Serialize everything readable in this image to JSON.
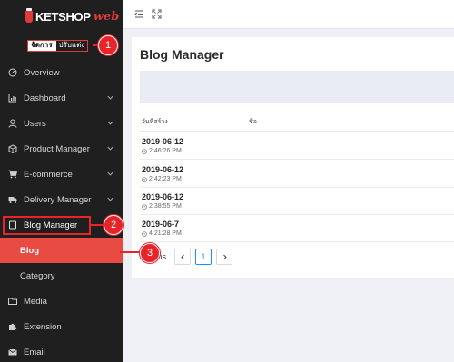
{
  "brand": {
    "name_main": "KETSHOP",
    "name_accent": "web",
    "accent_color": "#e23a3a"
  },
  "user": {
    "role_label": "จัดการ",
    "role_label2": "ปรับแต่ง"
  },
  "sidebar": {
    "items": [
      {
        "label": "Overview",
        "icon": "gauge-icon"
      },
      {
        "label": "Dashboard",
        "icon": "bar-chart-icon"
      },
      {
        "label": "Users",
        "icon": "user-icon"
      },
      {
        "label": "Product Manager",
        "icon": "box-icon"
      },
      {
        "label": "E-commerce",
        "icon": "cart-icon"
      },
      {
        "label": "Delivery Manager",
        "icon": "truck-icon"
      },
      {
        "label": "Blog Manager",
        "icon": "file-icon"
      }
    ],
    "sub_items": [
      {
        "label": "Blog",
        "active": true
      },
      {
        "label": "Category",
        "active": false
      }
    ],
    "bottom_items": [
      {
        "label": "Media",
        "icon": "folder-icon"
      },
      {
        "label": "Extension",
        "icon": "puzzle-icon"
      },
      {
        "label": "Email",
        "icon": "mail-icon"
      }
    ],
    "active_color": "#e84b43"
  },
  "main": {
    "title": "Blog Manager",
    "columns": [
      "วันที่สร้าง",
      "ชื่อ"
    ],
    "rows": [
      {
        "date": "2019-06-12",
        "time": "2:46:26 PM"
      },
      {
        "date": "2019-06-12",
        "time": "2:42:23 PM"
      },
      {
        "date": "2019-06-12",
        "time": "2:38:55 PM"
      },
      {
        "date": "2019-06-7",
        "time": "4:21:28 PM"
      }
    ],
    "pagination": {
      "total_text": "4 items",
      "current_page": "1"
    }
  },
  "annotations": [
    "1",
    "2",
    "3"
  ]
}
